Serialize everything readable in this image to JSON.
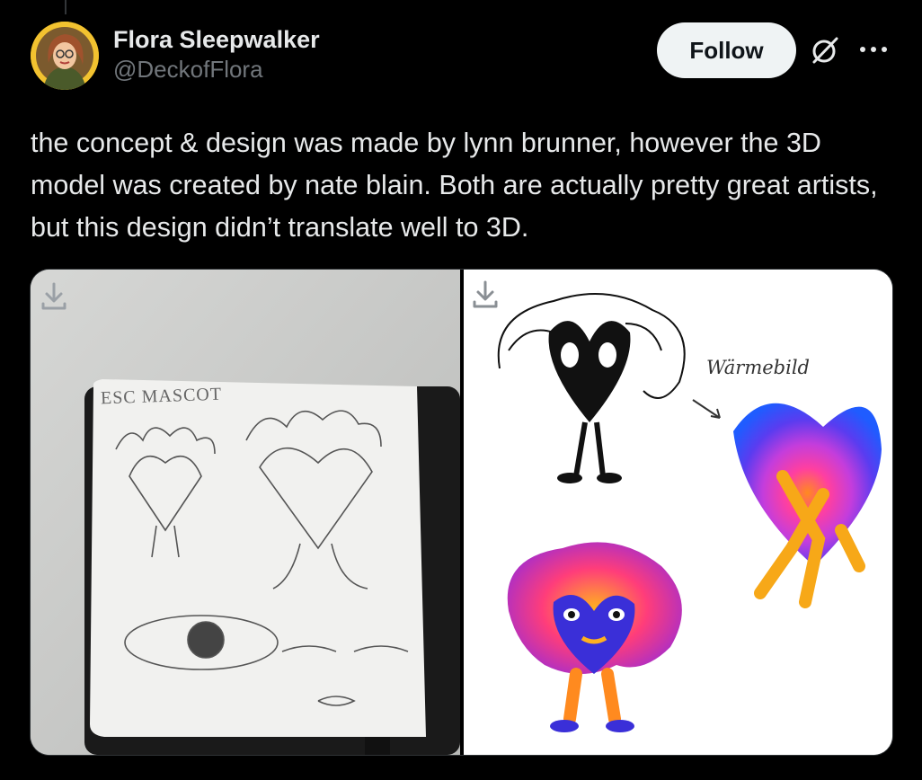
{
  "author": {
    "display_name": "Flora Sleepwalker",
    "handle": "@DeckofFlora"
  },
  "actions": {
    "follow_label": "Follow",
    "grok_icon": "grok-icon",
    "more_icon": "more-icon"
  },
  "tweet": {
    "text": "the concept & design was made by lynn brunner, however the 3D model was created by nate blain. Both are actually pretty great artists, but this design didn’t translate well to 3D."
  },
  "media": {
    "left_image": {
      "download_icon": "download-icon",
      "handwritten_label": "ESC MASCOT"
    },
    "right_image": {
      "download_icon": "download-icon",
      "handwritten_label": "Wärmebild"
    }
  },
  "colors": {
    "background": "#000000",
    "text": "#e7e9ea",
    "secondary_text": "#71767b",
    "follow_bg": "#eff3f4"
  }
}
